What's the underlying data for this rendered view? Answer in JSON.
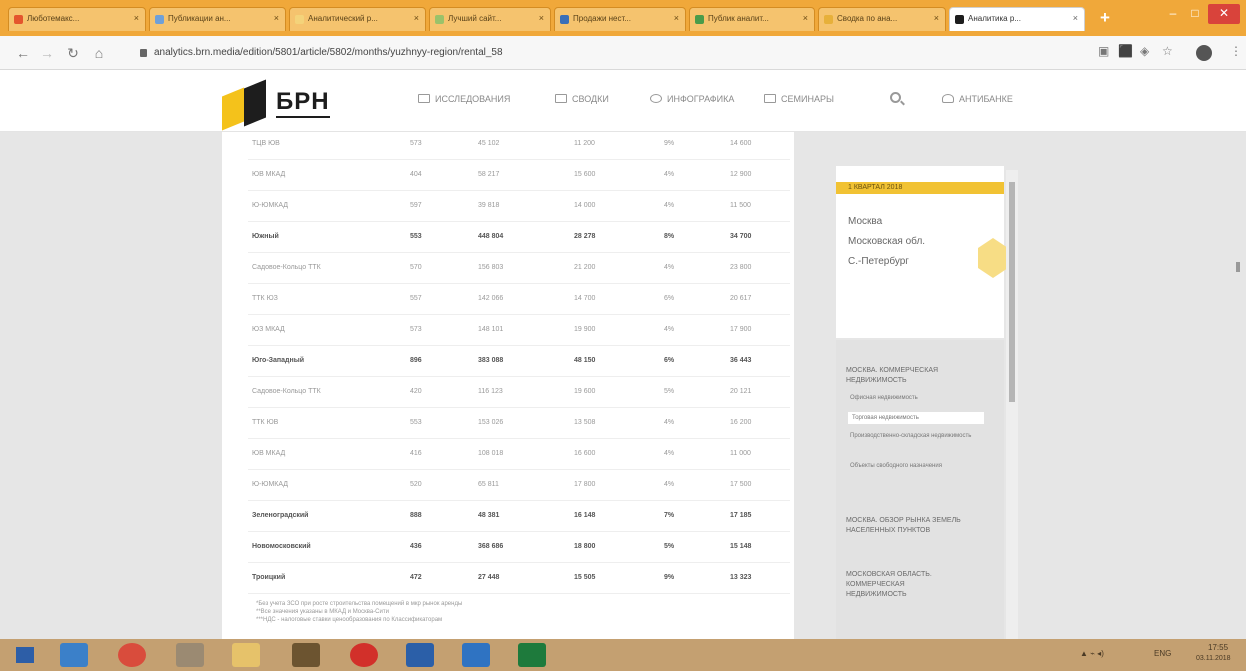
{
  "browser": {
    "tabs": [
      {
        "label": "Люботемакс..."
      },
      {
        "label": "Публикации ан..."
      },
      {
        "label": "Аналитический р..."
      },
      {
        "label": "Лучший сайт..."
      },
      {
        "label": "Продажи нест..."
      },
      {
        "label": "Публик аналит..."
      },
      {
        "label": "Сводка по ана..."
      },
      {
        "label": "Аналитика р..."
      }
    ],
    "new_tab": "+",
    "close_glyph": "×",
    "url": "analytics.brn.media/edition/5801/article/5802/months/yuzhnyy-region/rental_58",
    "window_buttons": {
      "min": "‒",
      "max": "□",
      "close": "✕"
    }
  },
  "site": {
    "logo": "БРН",
    "nav": [
      {
        "label": "ИССЛЕДОВАНИЯ"
      },
      {
        "label": "СВОДКИ"
      },
      {
        "label": "ИНФОГРАФИКА"
      },
      {
        "label": "СЕМИНАРЫ"
      },
      {
        "label": "АНТИБАНКЕ"
      }
    ]
  },
  "table": {
    "rows": [
      {
        "name": "ТЦВ ЮВ",
        "c1": "573",
        "c2": "45 102",
        "c3": "11 200",
        "c4": "9%",
        "c5": "14 600",
        "bold": false
      },
      {
        "name": "ЮВ МКАД",
        "c1": "404",
        "c2": "58 217",
        "c3": "15 600",
        "c4": "4%",
        "c5": "12 900",
        "bold": false
      },
      {
        "name": "Ю-ЮМКАД",
        "c1": "597",
        "c2": "39 818",
        "c3": "14 000",
        "c4": "4%",
        "c5": "11 500",
        "bold": false
      },
      {
        "name": "Южный",
        "c1": "553",
        "c2": "448 804",
        "c3": "28 278",
        "c4": "8%",
        "c5": "34 700",
        "bold": true
      },
      {
        "name": "Садовое-Кольцо ТТК",
        "c1": "570",
        "c2": "156 803",
        "c3": "21 200",
        "c4": "4%",
        "c5": "23 800",
        "bold": false
      },
      {
        "name": "ТТК ЮЗ",
        "c1": "557",
        "c2": "142 066",
        "c3": "14 700",
        "c4": "6%",
        "c5": "20 617",
        "bold": false
      },
      {
        "name": "ЮЗ МКАД",
        "c1": "573",
        "c2": "148 101",
        "c3": "19 900",
        "c4": "4%",
        "c5": "17 900",
        "bold": false
      },
      {
        "name": "Юго-Западный",
        "c1": "896",
        "c2": "383 088",
        "c3": "48 150",
        "c4": "6%",
        "c5": "36 443",
        "bold": true
      },
      {
        "name": "Садовое-Кольцо ТТК",
        "c1": "420",
        "c2": "116 123",
        "c3": "19 600",
        "c4": "5%",
        "c5": "20 121",
        "bold": false
      },
      {
        "name": "ТТК ЮВ",
        "c1": "553",
        "c2": "153 026",
        "c3": "13 508",
        "c4": "4%",
        "c5": "16 200",
        "bold": false
      },
      {
        "name": "ЮВ МКАД",
        "c1": "416",
        "c2": "108 018",
        "c3": "16 600",
        "c4": "4%",
        "c5": "11 000",
        "bold": false
      },
      {
        "name": "Ю-ЮМКАД",
        "c1": "520",
        "c2": "65 811",
        "c3": "17 800",
        "c4": "4%",
        "c5": "17 500",
        "bold": false
      },
      {
        "name": "Зеленоградский",
        "c1": "888",
        "c2": "48 381",
        "c3": "16 148",
        "c4": "7%",
        "c5": "17 185",
        "bold": true
      },
      {
        "name": "Новомосковский",
        "c1": "436",
        "c2": "368 686",
        "c3": "18 800",
        "c4": "5%",
        "c5": "15 148",
        "bold": true
      },
      {
        "name": "Троицкий",
        "c1": "472",
        "c2": "27 448",
        "c3": "15 505",
        "c4": "9%",
        "c5": "13 323",
        "bold": true
      }
    ],
    "notes": [
      "*Без учета ЗСО при росте строительства помещений в мкр рынок аренды",
      "**Все значения указаны в МКАД и Москва-Сити",
      "***НДС - налоговые ставки ценообразования по Классификаторам"
    ]
  },
  "sidebar": {
    "promo_date": "1 КВАРТАЛ 2018",
    "promo_lines": [
      "Москва",
      "Московская обл.",
      "С.-Петербург"
    ],
    "menu": [
      {
        "title": "МОСКВА. КОММЕРЧЕСКАЯ НЕДВИЖИМОСТЬ",
        "items": [
          "Офисная недвижимость",
          "Торговая недвижимость",
          "Производственно-складская недвижимость",
          "Объекты свободного назначения"
        ]
      },
      {
        "title": "МОСКВА. ОБЗОР РЫНКА ЗЕМЕЛЬ НАСЕЛЕННЫХ ПУНКТОВ",
        "items": []
      },
      {
        "title": "МОСКОВСКАЯ ОБЛАСТЬ. КОММЕРЧЕСКАЯ НЕДВИЖИМОСТЬ",
        "items": []
      }
    ]
  },
  "taskbar": {
    "tray_lang": "ENG",
    "time": "17:55",
    "date": "03.11.2018"
  }
}
